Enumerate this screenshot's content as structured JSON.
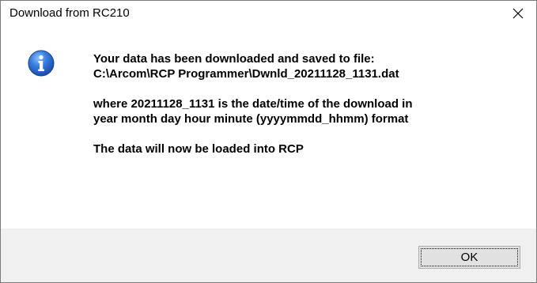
{
  "window": {
    "title": "Download from RC210",
    "close_icon": "close-icon"
  },
  "message": {
    "icon": "info-icon",
    "line1": "Your data has been downloaded and saved to file:",
    "line2": "C:\\Arcom\\RCP Programmer\\Dwnld_20211128_1131.dat",
    "line3": "where 20211128_1131 is the date/time of the download in",
    "line4": "year month day hour minute (yyyymmdd_hhmm) format",
    "line5": "The data will now be loaded into RCP"
  },
  "buttons": {
    "ok_label": "OK"
  },
  "colors": {
    "info_icon_blue": "#1f5fbf",
    "footer_bg": "#f0f0f0",
    "button_bg": "#e1e1e1"
  }
}
